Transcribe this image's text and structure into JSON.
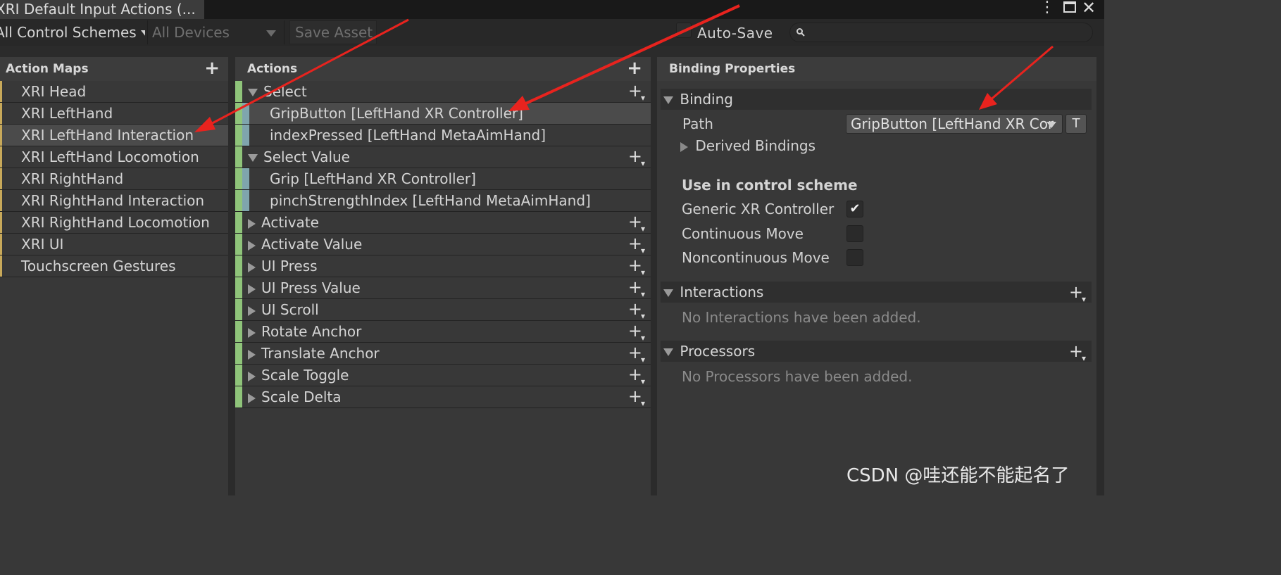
{
  "window": {
    "tab_title": "XRI Default Input Actions (...",
    "icons": [
      "more-vert-icon",
      "maximize-icon",
      "close-icon"
    ]
  },
  "toolbar": {
    "control_schemes": "All Control Schemes",
    "devices": "All Devices",
    "save_asset": "Save Asset",
    "auto_save": "Auto-Save",
    "search_value": ""
  },
  "action_maps": {
    "header": "Action Maps",
    "items": [
      {
        "label": "XRI Head",
        "selected": false
      },
      {
        "label": "XRI LeftHand",
        "selected": false
      },
      {
        "label": "XRI LeftHand Interaction",
        "selected": true
      },
      {
        "label": "XRI LeftHand Locomotion",
        "selected": false
      },
      {
        "label": "XRI RightHand",
        "selected": false
      },
      {
        "label": "XRI RightHand Interaction",
        "selected": false
      },
      {
        "label": "XRI RightHand Locomotion",
        "selected": false
      },
      {
        "label": "XRI UI",
        "selected": false
      },
      {
        "label": "Touchscreen Gestures",
        "selected": false
      }
    ]
  },
  "actions": {
    "header": "Actions",
    "rows": [
      {
        "type": "action",
        "label": "Select",
        "expanded": true
      },
      {
        "type": "binding",
        "label": "GripButton [LeftHand XR Controller]",
        "selected": true
      },
      {
        "type": "binding",
        "label": "indexPressed [LeftHand MetaAimHand]"
      },
      {
        "type": "action",
        "label": "Select Value",
        "expanded": true
      },
      {
        "type": "binding",
        "label": "Grip [LeftHand XR Controller]"
      },
      {
        "type": "binding",
        "label": "pinchStrengthIndex [LeftHand MetaAimHand]"
      },
      {
        "type": "action",
        "label": "Activate",
        "expanded": false
      },
      {
        "type": "action",
        "label": "Activate Value",
        "expanded": false
      },
      {
        "type": "action",
        "label": "UI Press",
        "expanded": false
      },
      {
        "type": "action",
        "label": "UI Press Value",
        "expanded": false
      },
      {
        "type": "action",
        "label": "UI Scroll",
        "expanded": false
      },
      {
        "type": "action",
        "label": "Rotate Anchor",
        "expanded": false
      },
      {
        "type": "action",
        "label": "Translate Anchor",
        "expanded": false
      },
      {
        "type": "action",
        "label": "Scale Toggle",
        "expanded": false
      },
      {
        "type": "action",
        "label": "Scale Delta",
        "expanded": false
      }
    ]
  },
  "binding_properties": {
    "header": "Binding Properties",
    "binding_section": "Binding",
    "path_label": "Path",
    "path_value": "GripButton [LeftHand XR Cor",
    "t_button": "T",
    "derived_bindings": "Derived Bindings",
    "control_scheme_title": "Use in control scheme",
    "schemes": [
      {
        "label": "Generic XR Controller",
        "checked": true
      },
      {
        "label": "Continuous Move",
        "checked": false
      },
      {
        "label": "Noncontinuous Move",
        "checked": false
      }
    ],
    "interactions_section": "Interactions",
    "interactions_empty": "No Interactions have been added.",
    "processors_section": "Processors",
    "processors_empty": "No Processors have been added."
  },
  "watermark": "CSDN @哇还能不能起名了",
  "colors": {
    "action_accent": "#8fc47a",
    "binding_accent": "#7fa5ad",
    "map_accent": "#c8a95a",
    "annotation_arrow": "#e8231e"
  }
}
